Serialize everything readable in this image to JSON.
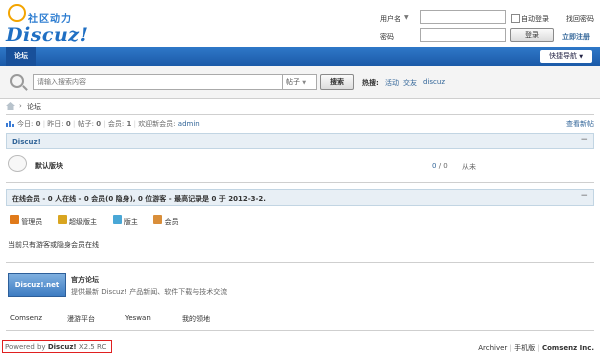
{
  "brand": {
    "top": "社区动力",
    "logo": "Discuz!"
  },
  "login": {
    "username_label": "用户名",
    "password_label": "密码",
    "auto_login": "自动登录",
    "forgot": "找回密码",
    "login_button": "登录",
    "register": "立即注册"
  },
  "nav": {
    "tab": "论坛",
    "quick": "快捷导航"
  },
  "search": {
    "placeholder": "请输入搜索内容",
    "scope": "帖子",
    "button": "搜索",
    "hot_label": "热搜:",
    "hot": [
      "活动",
      "交友",
      "discuz"
    ]
  },
  "breadcrumb": {
    "current": "论坛"
  },
  "stats": {
    "today_label": "今日:",
    "today": "0",
    "yesterday_label": "昨日:",
    "yesterday": "0",
    "posts_label": "帖子:",
    "posts": "0",
    "members_label": "会员:",
    "members": "1",
    "welcome": "欢迎新会员:",
    "new_member": "admin",
    "new_posts": "查看新帖"
  },
  "category": {
    "title": "Discuz!",
    "collapse": "−",
    "forum_name": "默认版块",
    "threads": "0",
    "posts": "0",
    "last": "从未"
  },
  "online": {
    "title": "在线会员 - 0 人在线 - 0 会员(0 隐身), 0 位游客 - 最高记录是 0 于 2012-3-2.",
    "collapse": "−",
    "roles": [
      "管理员",
      "超级版主",
      "版主",
      "会员"
    ],
    "note": "当前只有游客或隐身会员在线"
  },
  "links": {
    "site_title": "官方论坛",
    "site_desc": "提供最新 Discuz! 产品新闻、软件下载与技术交流",
    "banner": "Discuz!.net",
    "items": [
      "Comsenz",
      "漫游平台",
      "Yeswan",
      "我的领地"
    ]
  },
  "footer": {
    "powered": "Powered by",
    "product": "Discuz!",
    "version": "X2.5 RC",
    "archiver": "Archiver",
    "mobile": "手机版",
    "company": "Comsenz Inc."
  },
  "colors": {
    "nav": "#1f64b5",
    "accent": "#336699",
    "panel_head": "#e8eff5"
  }
}
